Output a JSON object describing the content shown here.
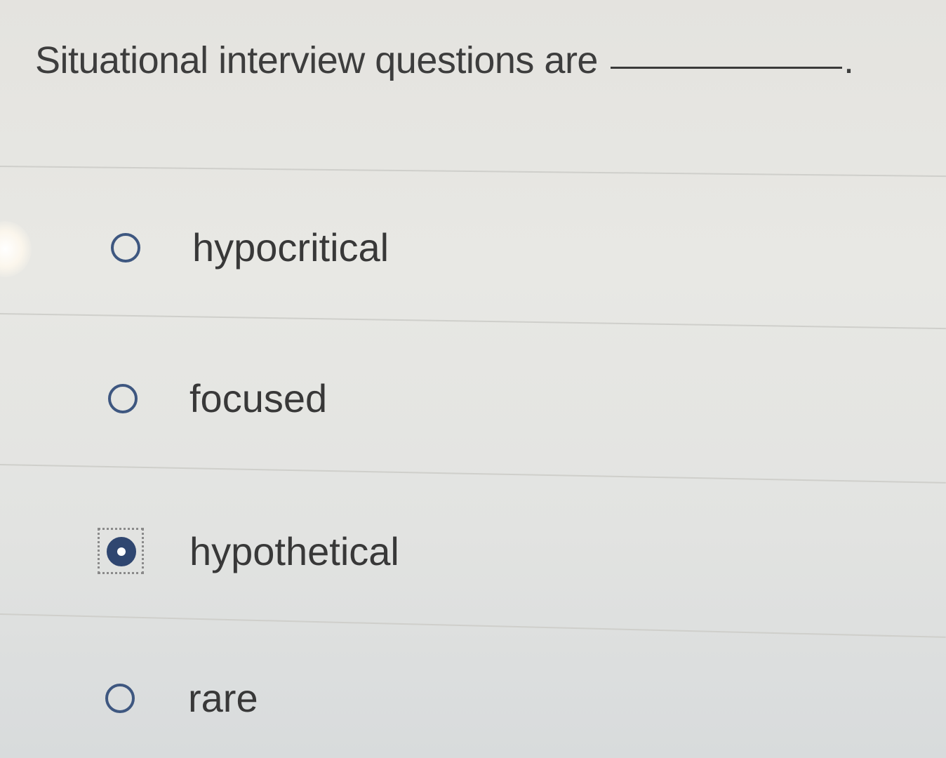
{
  "question": {
    "text": "Situational interview questions are",
    "period": "."
  },
  "options": [
    {
      "label": "hypocritical",
      "selected": false
    },
    {
      "label": "focused",
      "selected": false
    },
    {
      "label": "hypothetical",
      "selected": true
    },
    {
      "label": "rare",
      "selected": false
    }
  ],
  "colors": {
    "radio_accent": "#2f4670",
    "text": "#3a3a3a",
    "background": "#e6e6e2"
  }
}
